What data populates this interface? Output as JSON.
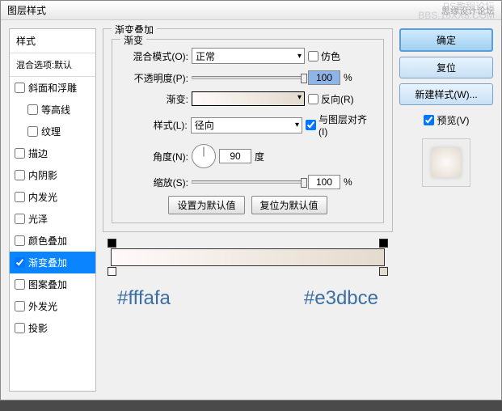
{
  "titlebar": {
    "title": "图层样式",
    "right": "思缘设计论坛"
  },
  "watermark": {
    "line1": "PS教程论坛",
    "line2": "BBS.16XX8.COM"
  },
  "leftPanel": {
    "header": "样式",
    "sub": "混合选项:默认",
    "items": [
      {
        "label": "斜面和浮雕",
        "checked": false
      },
      {
        "label": "等高线",
        "checked": false,
        "indent": true
      },
      {
        "label": "纹理",
        "checked": false,
        "indent": true
      },
      {
        "label": "描边",
        "checked": false
      },
      {
        "label": "内阴影",
        "checked": false
      },
      {
        "label": "内发光",
        "checked": false
      },
      {
        "label": "光泽",
        "checked": false
      },
      {
        "label": "颜色叠加",
        "checked": false
      },
      {
        "label": "渐变叠加",
        "checked": true,
        "selected": true
      },
      {
        "label": "图案叠加",
        "checked": false
      },
      {
        "label": "外发光",
        "checked": false
      },
      {
        "label": "投影",
        "checked": false
      }
    ]
  },
  "center": {
    "outerTitle": "渐变叠加",
    "innerTitle": "渐变",
    "blendMode": {
      "label": "混合模式(O):",
      "value": "正常"
    },
    "dither": {
      "label": "仿色"
    },
    "opacity": {
      "label": "不透明度(P):",
      "value": "100",
      "unit": "%"
    },
    "gradient": {
      "label": "渐变:"
    },
    "reverse": {
      "label": "反向(R)"
    },
    "style": {
      "label": "样式(L):",
      "value": "径向"
    },
    "alignLayer": {
      "label": "与图层对齐(I)"
    },
    "angle": {
      "label": "角度(N):",
      "value": "90",
      "unit": "度"
    },
    "scale": {
      "label": "缩放(S):",
      "value": "100",
      "unit": "%"
    },
    "btnDefault": "设置为默认值",
    "btnReset": "复位为默认值",
    "color1": "#fffafa",
    "color2": "#e3dbce"
  },
  "right": {
    "ok": "确定",
    "cancel": "复位",
    "newStyle": "新建样式(W)...",
    "preview": "预览(V)"
  }
}
